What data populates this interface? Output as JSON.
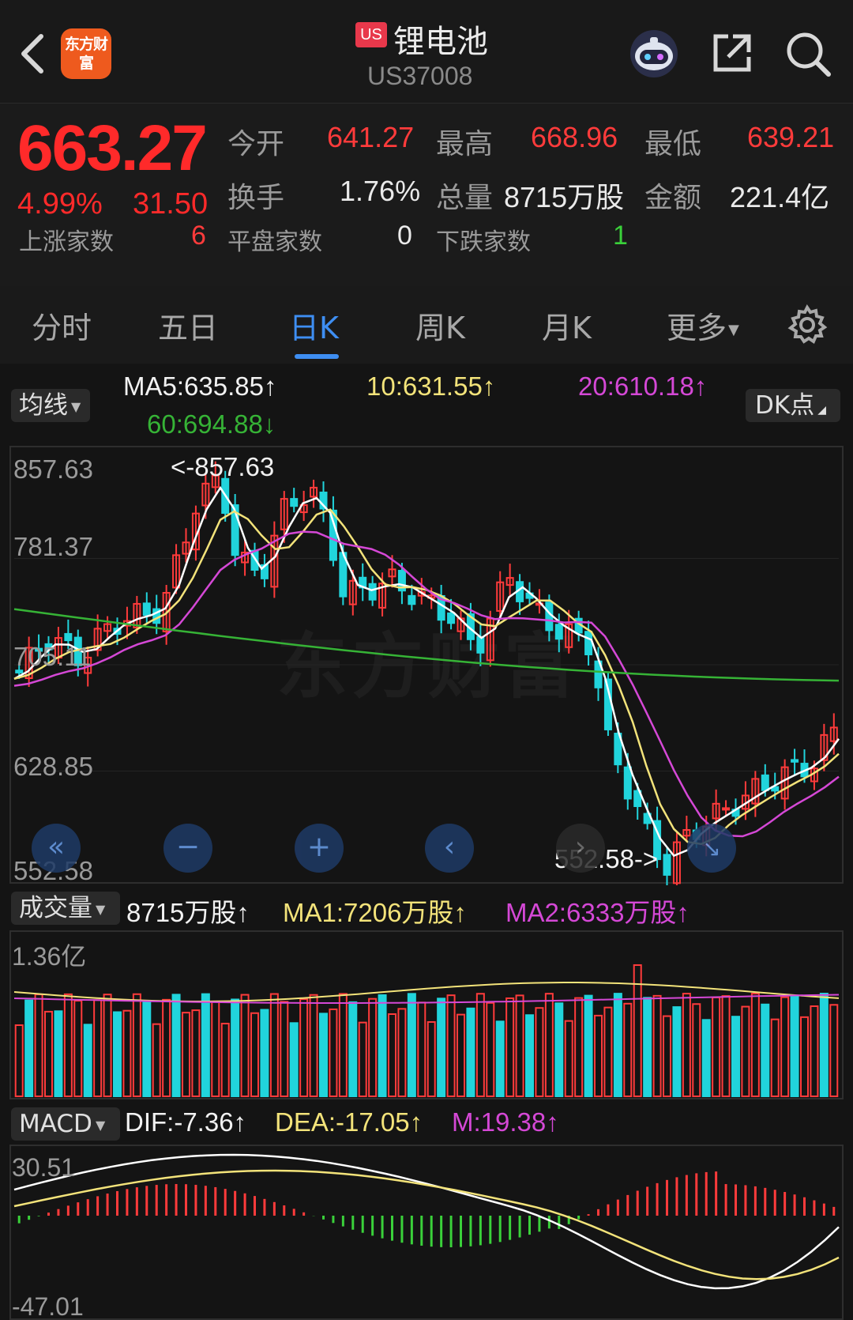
{
  "header": {
    "logo_text": "东方财富",
    "market_badge": "US",
    "title": "锂电池",
    "code": "US37008"
  },
  "quote": {
    "price": "663.27",
    "change_pct": "4.99%",
    "change_abs": "31.50",
    "open_label": "今开",
    "open_value": "641.27",
    "high_label": "最高",
    "high_value": "668.96",
    "low_label": "最低",
    "low_value": "639.21",
    "turnover_label": "换手",
    "turnover_value": "1.76%",
    "volume_label": "总量",
    "volume_value": "8715万股",
    "amount_label": "金额",
    "amount_value": "221.4亿",
    "up_count_label": "上涨家数",
    "up_count": "6",
    "flat_count_label": "平盘家数",
    "flat_count": "0",
    "down_count_label": "下跌家数",
    "down_count": "1"
  },
  "tabs": [
    {
      "label": "分时"
    },
    {
      "label": "五日"
    },
    {
      "label": "日K"
    },
    {
      "label": "周K"
    },
    {
      "label": "月K"
    },
    {
      "label": "更多"
    }
  ],
  "active_tab": "日K",
  "ma_row": {
    "selector": "均线",
    "ma5": "MA5:635.85↑",
    "ma10": "10:631.55↑",
    "ma20": "20:610.18↑",
    "ma60": "60:694.88↓",
    "dk_button": "DK点"
  },
  "volume_row": {
    "selector": "成交量",
    "volume": "8715万股↑",
    "ma1": "MA1:7206万股↑",
    "ma2": "MA2:6333万股↑"
  },
  "macd_row": {
    "selector": "MACD",
    "dif": "DIF:-7.36↑",
    "dea": "DEA:-17.05↑",
    "m": "M:19.38↑"
  },
  "colors": {
    "up": "#ff3b3b",
    "down": "#21d4dc",
    "ma5": "#ffffff",
    "ma10": "#f3e37a",
    "ma20": "#d548d6",
    "ma60": "#36b336",
    "accent": "#3e8ef2"
  },
  "controls": {
    "left_icon": "double-left-icon",
    "zoom_out_icon": "minus-icon",
    "zoom_in_icon": "plus-icon",
    "prev_icon": "chevron-left-icon",
    "next_icon": "chevron-right-icon",
    "reset_icon": "arrow-down-right-icon"
  },
  "chart_data": [
    {
      "type": "candlestick",
      "title": "",
      "y_ticks": [
        "857.63",
        "781.37",
        "705.11",
        "628.85",
        "552.58"
      ],
      "ylim": [
        552.58,
        857.63
      ],
      "annotations": [
        "<-857.63",
        "552.58->"
      ],
      "series": [
        {
          "name": "MA5",
          "last": 635.85
        },
        {
          "name": "10",
          "last": 631.55
        },
        {
          "name": "20",
          "last": 610.18
        },
        {
          "name": "60",
          "last": 694.88
        }
      ],
      "last_close": 663.27
    },
    {
      "type": "bar",
      "title": "成交量",
      "y_ticks": [
        "1.36亿"
      ],
      "series": [
        {
          "name": "MA1",
          "last": "7206万股"
        },
        {
          "name": "MA2",
          "last": "6333万股"
        }
      ],
      "last_value": "8715万股"
    },
    {
      "type": "bar",
      "title": "MACD",
      "y_ticks": [
        "30.51",
        "-47.01"
      ],
      "ylim": [
        -47.01,
        30.51
      ],
      "series": [
        {
          "name": "DIF",
          "last": -7.36
        },
        {
          "name": "DEA",
          "last": -17.05
        },
        {
          "name": "M",
          "last": 19.38
        }
      ]
    }
  ]
}
